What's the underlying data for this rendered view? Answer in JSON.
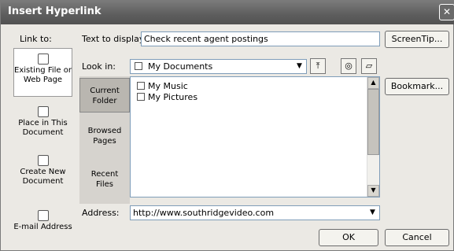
{
  "window": {
    "title": "Insert Hyperlink",
    "close_glyph": "✕"
  },
  "link_to": {
    "heading": "Link to:",
    "items": [
      {
        "label_lines": [
          "Existing File or",
          "Web Page"
        ],
        "icon": "web-page-icon"
      },
      {
        "label_lines": [
          "Place in This",
          "Document"
        ],
        "icon": "document-place-icon"
      },
      {
        "label_lines": [
          "Create New",
          "Document"
        ],
        "icon": "new-document-icon"
      },
      {
        "label_lines": [
          "E-mail Address"
        ],
        "icon": "email-icon"
      }
    ]
  },
  "text_to_display": {
    "label": "Text to display:",
    "value": "Check recent agent postings"
  },
  "screentip_button": "ScreenTip...",
  "look_in": {
    "label": "Look in:",
    "value": "My Documents"
  },
  "tabs": [
    {
      "label_lines": [
        "Current",
        "Folder"
      ]
    },
    {
      "label_lines": [
        "Browsed",
        "Pages"
      ]
    },
    {
      "label_lines": [
        "Recent",
        "Files"
      ]
    }
  ],
  "files": [
    {
      "name": "My Music"
    },
    {
      "name": "My Pictures"
    }
  ],
  "bookmark_button": "Bookmark...",
  "address": {
    "label": "Address:",
    "value": "http://www.southridgevideo.com"
  },
  "ok_button": "OK",
  "cancel_button": "Cancel",
  "colors": {
    "titlebar": "#5d5d5d",
    "dialog_bg": "#ebe9e4"
  }
}
